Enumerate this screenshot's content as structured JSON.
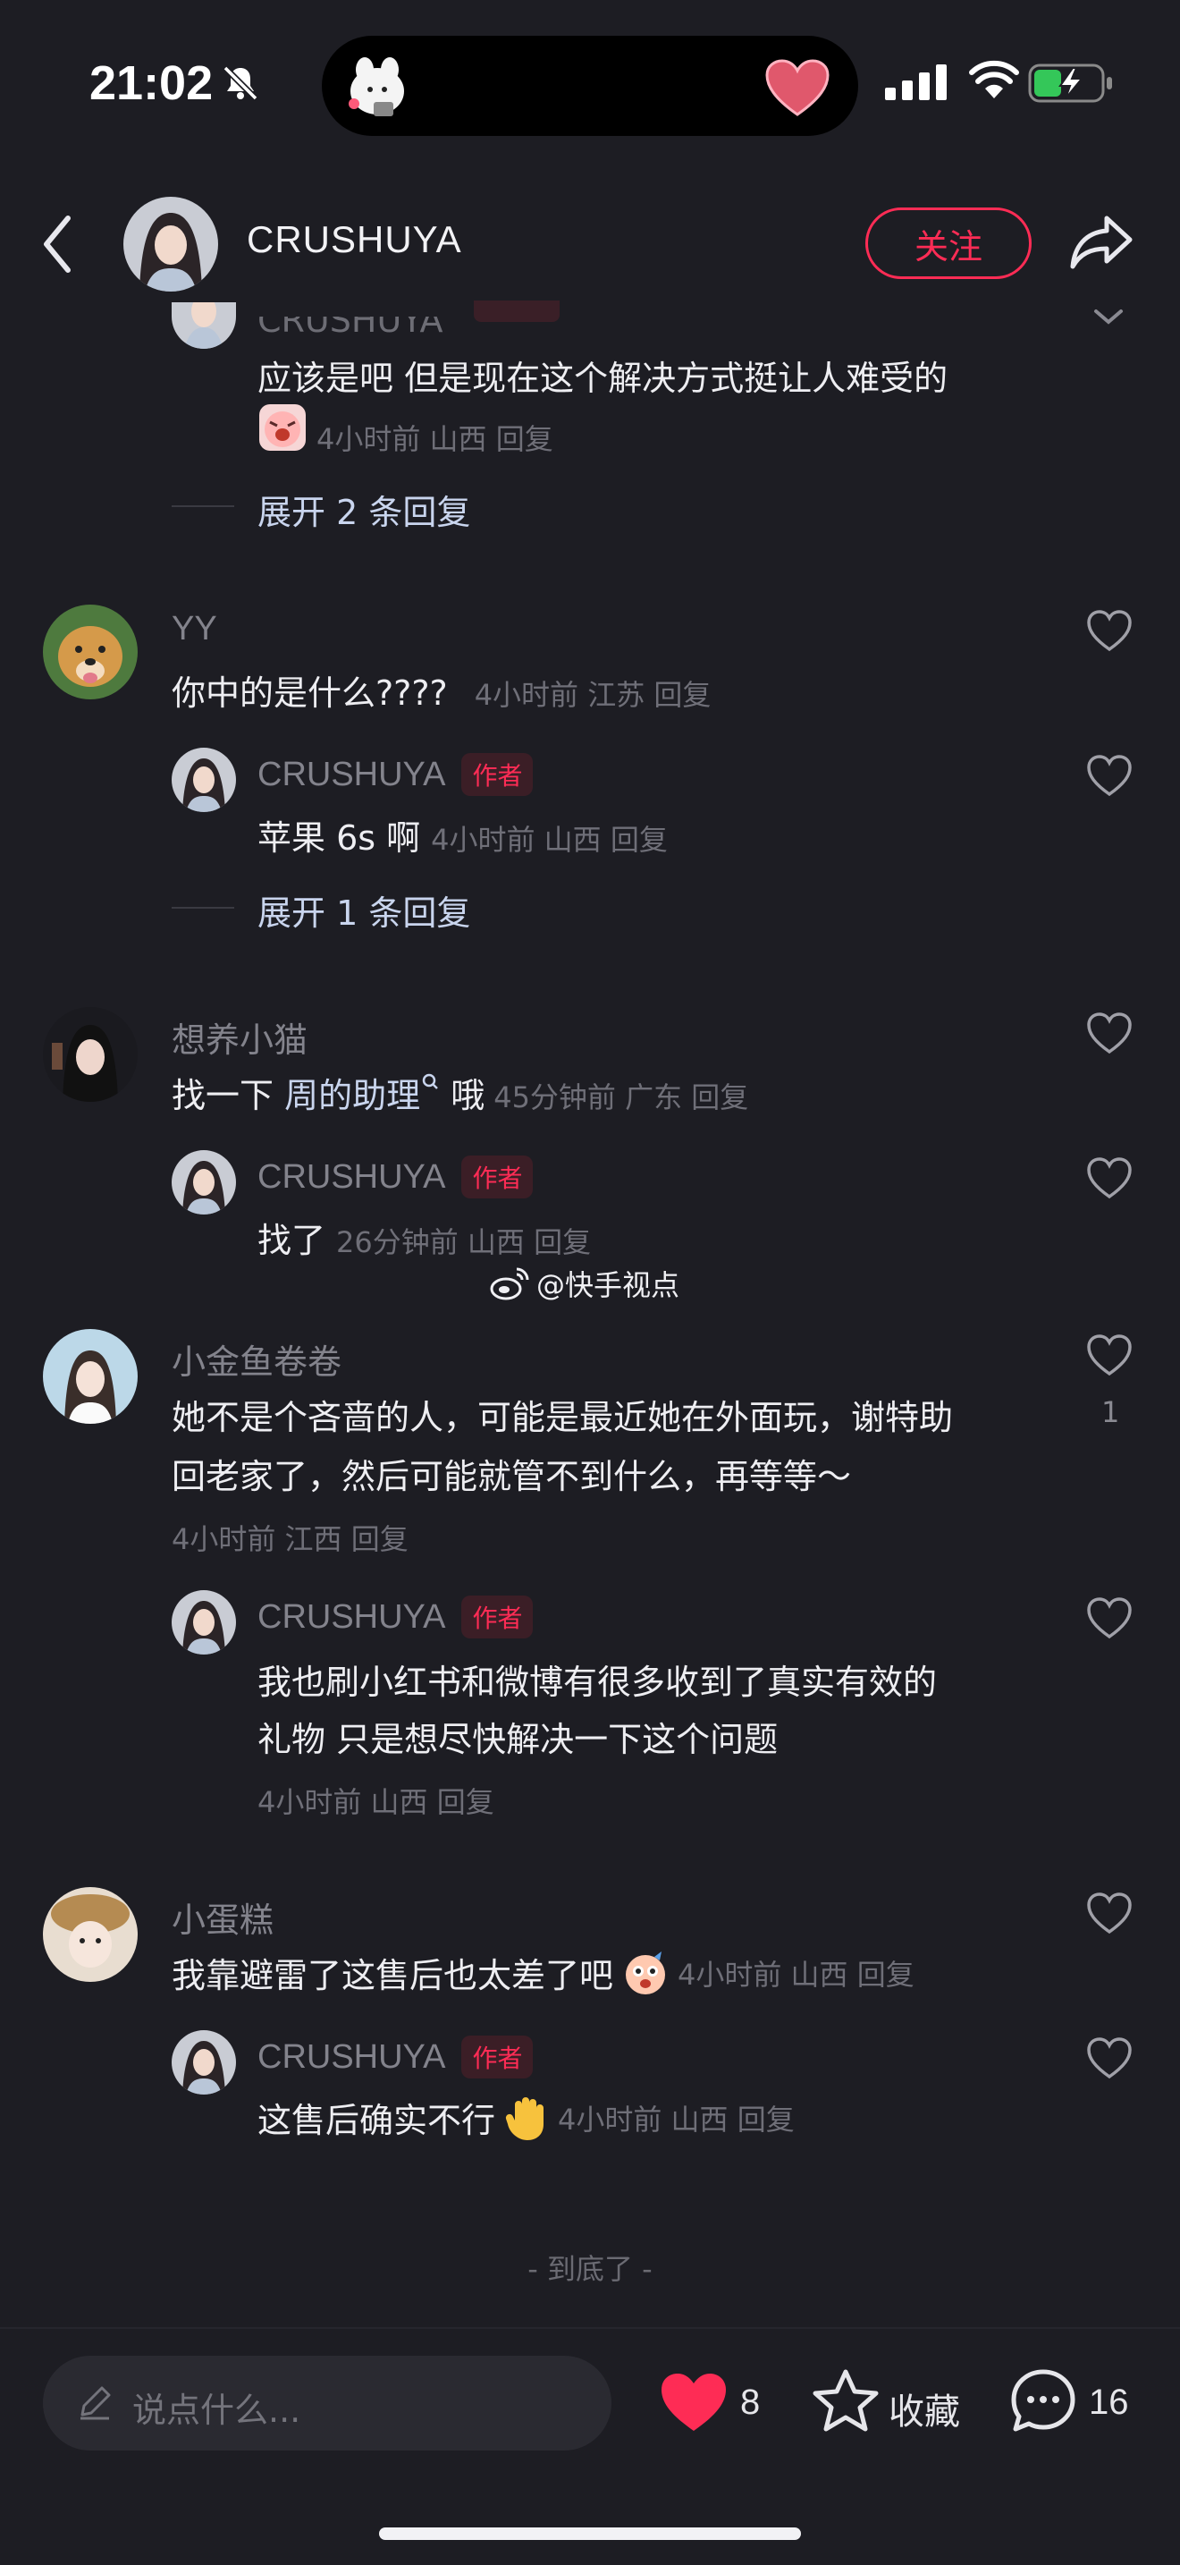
{
  "status_bar": {
    "time": "21:02"
  },
  "header": {
    "username": "CRUSHUYA",
    "follow_label": "关注"
  },
  "top_reply": {
    "partial_name": "CRUSHUYA",
    "text": "应该是吧 但是现在这个解决方式挺让人难受的",
    "meta": "4小时前 山西 回复",
    "expand": "展开 2 条回复"
  },
  "comments": [
    {
      "user": "YY",
      "text": "你中的是什么????",
      "meta": "4小时前 江苏 回复",
      "reply": {
        "user": "CRUSHUYA",
        "tag": "作者",
        "text": "苹果 6s 啊",
        "meta": "4小时前 山西 回复"
      },
      "expand": "展开 1 条回复"
    },
    {
      "user": "想养小猫",
      "text_before": "找一下 ",
      "link": "周的助理",
      "text_after": " 哦",
      "meta": "45分钟前 广东 回复",
      "reply": {
        "user": "CRUSHUYA",
        "tag": "作者",
        "text": "找了",
        "meta": "26分钟前 山西 回复"
      }
    },
    {
      "user": "小金鱼卷卷",
      "text_line1": "她不是个吝啬的人，可能是最近她在外面玩，谢特助",
      "text_line2": "回老家了，然后可能就管不到什么，再等等～",
      "meta": "4小时前 江西 回复",
      "likes": "1",
      "reply": {
        "user": "CRUSHUYA",
        "tag": "作者",
        "text_line1": "我也刷小红书和微博有很多收到了真实有效的",
        "text_line2": "礼物 只是想尽快解决一下这个问题",
        "meta": "4小时前 山西 回复"
      }
    },
    {
      "user": "小蛋糕",
      "text": "我靠避雷了这售后也太差了吧",
      "meta": "4小时前 山西 回复",
      "reply": {
        "user": "CRUSHUYA",
        "tag": "作者",
        "text": "这售后确实不行",
        "meta": "4小时前 山西 回复"
      }
    }
  ],
  "watermark": "@快手视点",
  "end_text": "- 到底了 -",
  "bottom_bar": {
    "input_placeholder": "说点什么...",
    "like_count": "8",
    "favorite_label": "收藏",
    "comment_count": "16"
  },
  "colors": {
    "accent": "#fe2c55",
    "background": "#1d1d23",
    "link": "#c9d5ee"
  }
}
